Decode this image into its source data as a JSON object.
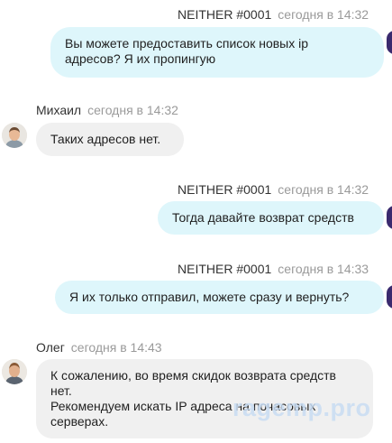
{
  "messages": [
    {
      "author": "NEITHER #0001",
      "time": "сегодня в 14:32",
      "direction": "outgoing",
      "lines": [
        "Вы можете предоставить список новых ip",
        "адресов? Я их пропингую"
      ]
    },
    {
      "author": "Михаил",
      "time": "сегодня в 14:32",
      "direction": "incoming",
      "avatar": "male-avatar-icon",
      "lines": [
        "Таких адресов нет."
      ]
    },
    {
      "author": "NEITHER #0001",
      "time": "сегодня в 14:32",
      "direction": "outgoing",
      "lines": [
        "Тогда давайте возврат средств"
      ]
    },
    {
      "author": "NEITHER #0001",
      "time": "сегодня в 14:33",
      "direction": "outgoing",
      "lines": [
        "Я их только отправил, можете сразу и вернуть?"
      ]
    },
    {
      "author": "Олег",
      "time": "сегодня в 14:43",
      "direction": "incoming",
      "avatar": "male-avatar-icon",
      "lines": [
        "К сожалению, во время скидок возврата средств",
        "нет.",
        "Рекомендуем искать IP адреса на почасовых",
        "серверах."
      ]
    }
  ],
  "watermark": "ragemp.pro",
  "colors": {
    "outgoing_bubble": "#def6fb",
    "incoming_bubble": "#f0f0f0",
    "time_text": "#9a9a9a",
    "own_avatar": "#3a2a6e",
    "watermark": "#c9ddf3"
  }
}
